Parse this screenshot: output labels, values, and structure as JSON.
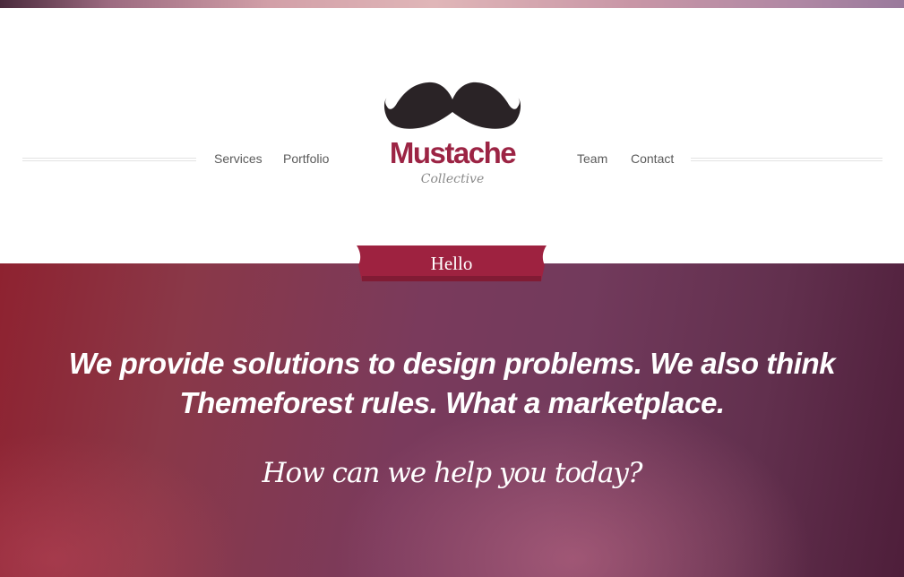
{
  "nav": {
    "left": [
      "Services",
      "Portfolio"
    ],
    "right": [
      "Team",
      "Contact"
    ]
  },
  "logo": {
    "title": "Mustache",
    "subtitle": "Collective",
    "icon": "mustache-icon"
  },
  "ribbon": {
    "label": "Hello"
  },
  "hero": {
    "headline_line1": "We provide solutions to design problems. We also think",
    "headline_line2": "Themeforest rules. What a marketplace.",
    "tagline": "How can we help you today?"
  },
  "colors": {
    "brand": "#9c2444",
    "ribbon": "#9e2240",
    "nav_text": "#5a5a5a",
    "mustache": "#2a2326"
  }
}
